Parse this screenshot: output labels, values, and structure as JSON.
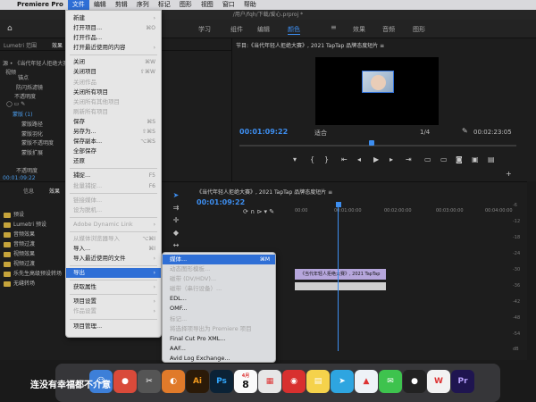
{
  "menubar": {
    "app_name": "Premiere Pro",
    "items": [
      "文件",
      "编辑",
      "剪辑",
      "序列",
      "标记",
      "图形",
      "视图",
      "窗口",
      "帮助"
    ]
  },
  "app_header": {
    "path": "/用户/fqh/下载/爱心.prproj *"
  },
  "workspaces": {
    "items": [
      "学习",
      "组件",
      "编辑",
      "颜色",
      "效果",
      "音频",
      "图形"
    ],
    "active": "颜色"
  },
  "left_top": {
    "tabs": [
      "Lumetri 范围",
      "效果"
    ],
    "rows": [
      "源 • 《当代年轻人拒绝大赛》",
      "视频",
      "锚点",
      "防闪烁滤镜",
      "不透明度",
      "蒙版 (1)",
      "蒙版路径",
      "蒙版羽化",
      "蒙版不透明度",
      "蒙版扩展",
      "不透明度"
    ],
    "timecode": "00:01:09:22"
  },
  "left_bottom": {
    "tabs": [
      "信息",
      "效果"
    ],
    "folders": [
      "预设",
      "Lumetri 预设",
      "音频效果",
      "音频过渡",
      "视频效果",
      "视频过渡",
      "乐先生高级预设转场",
      "无缝转场"
    ]
  },
  "program": {
    "title": "节目:《当代年轻人拒绝大赛》, 2021 TapTap 品牌态度短片 ≡",
    "timecode": "00:01:09:22",
    "fit": "适合",
    "quality": "1/4",
    "duration": "00:02:23:05"
  },
  "timeline": {
    "title": "《当代年轻人拒绝大赛》, 2021 TapTap 品牌态度短片 ≡",
    "timecode": "00:01:09:22",
    "ruler": [
      "00:00",
      "00:01:00:00",
      "00:02:00:00",
      "00:03:00:00",
      "00:04:00:00"
    ],
    "clip_video": "《当代年轻人拒绝大赛》, 2021 TapTap",
    "meter_labels": [
      "-6",
      "-12",
      "-18",
      "-24",
      "-30",
      "-36",
      "-42",
      "-48",
      "-54",
      "dB"
    ]
  },
  "file_menu": [
    {
      "label": "新建",
      "sc": "›",
      "dis": false
    },
    {
      "label": "打开项目...",
      "sc": "⌘O",
      "dis": false
    },
    {
      "label": "打开作品...",
      "sc": "",
      "dis": false
    },
    {
      "label": "打开最近使用的内容",
      "sc": "›",
      "dis": false
    },
    {
      "sep": true
    },
    {
      "label": "关闭",
      "sc": "⌘W",
      "dis": false
    },
    {
      "label": "关闭项目",
      "sc": "⇧⌘W",
      "dis": false
    },
    {
      "label": "关闭作品",
      "sc": "",
      "dis": true
    },
    {
      "label": "关闭所有项目",
      "sc": "",
      "dis": false
    },
    {
      "label": "关闭所有其他项目",
      "sc": "",
      "dis": true
    },
    {
      "label": "刷新所有项目",
      "sc": "",
      "dis": true
    },
    {
      "label": "保存",
      "sc": "⌘S",
      "dis": false
    },
    {
      "label": "另存为...",
      "sc": "⇧⌘S",
      "dis": false
    },
    {
      "label": "保存副本...",
      "sc": "⌥⌘S",
      "dis": false
    },
    {
      "label": "全部保存",
      "sc": "",
      "dis": false
    },
    {
      "label": "还原",
      "sc": "",
      "dis": false
    },
    {
      "sep": true
    },
    {
      "label": "捕捉...",
      "sc": "F5",
      "dis": false
    },
    {
      "label": "批量捕捉...",
      "sc": "F6",
      "dis": true
    },
    {
      "sep": true
    },
    {
      "label": "链接媒体...",
      "sc": "",
      "dis": true
    },
    {
      "label": "设为脱机...",
      "sc": "",
      "dis": true
    },
    {
      "sep": true
    },
    {
      "label": "Adobe Dynamic Link",
      "sc": "›",
      "dis": true
    },
    {
      "sep": true
    },
    {
      "label": "从媒体浏览器导入",
      "sc": "⌥⌘I",
      "dis": true
    },
    {
      "label": "导入...",
      "sc": "⌘I",
      "dis": false
    },
    {
      "label": "导入最近使用的文件",
      "sc": "›",
      "dis": false
    },
    {
      "sep": true
    },
    {
      "label": "导出",
      "sc": "›",
      "dis": false,
      "hl": true
    },
    {
      "sep": true
    },
    {
      "label": "获取属性",
      "sc": "›",
      "dis": false
    },
    {
      "sep": true
    },
    {
      "label": "项目设置",
      "sc": "›",
      "dis": false
    },
    {
      "label": "作品设置",
      "sc": "›",
      "dis": true
    },
    {
      "sep": true
    },
    {
      "label": "项目管理...",
      "sc": "",
      "dis": false
    }
  ],
  "export_menu": [
    {
      "label": "媒体...",
      "sc": "⌘M",
      "dis": false,
      "hl": true
    },
    {
      "label": "动态图形模板...",
      "sc": "",
      "dis": true
    },
    {
      "label": "磁带 (DV/HDV)...",
      "sc": "",
      "dis": true
    },
    {
      "label": "磁带（串行设备）...",
      "sc": "",
      "dis": true
    },
    {
      "label": "EDL...",
      "sc": "",
      "dis": false
    },
    {
      "label": "OMF...",
      "sc": "",
      "dis": false
    },
    {
      "label": "标记...",
      "sc": "",
      "dis": true
    },
    {
      "label": "将选择项导出为 Premiere 项目",
      "sc": "",
      "dis": true
    },
    {
      "label": "Final Cut Pro XML...",
      "sc": "",
      "dis": false
    },
    {
      "label": "AAF...",
      "sc": "",
      "dis": false
    },
    {
      "label": "Avid Log Exchange...",
      "sc": "",
      "dis": false
    }
  ],
  "dock": {
    "caption": "连没有幸福都不介意",
    "calendar_day": "8",
    "calendar_month": "4月",
    "icons": [
      {
        "name": "finder-icon",
        "glyph": "☺",
        "bg": "#3d7fd8"
      },
      {
        "name": "chrome-icon",
        "glyph": "●",
        "bg": "#d94a3a"
      },
      {
        "name": "screenshot-icon",
        "glyph": "✂",
        "bg": "#555"
      },
      {
        "name": "color-picker-icon",
        "glyph": "◐",
        "bg": "#e07a2a"
      },
      {
        "name": "illustrator-icon",
        "glyph": "Ai",
        "bg": "#2b1a08"
      },
      {
        "name": "photoshop-icon",
        "glyph": "Ps",
        "bg": "#0b2236"
      },
      {
        "name": "calendar-icon",
        "glyph": "",
        "bg": "#fafafa"
      },
      {
        "name": "launchpad-icon",
        "glyph": "▦",
        "bg": "#e6e6e6"
      },
      {
        "name": "netease-music-icon",
        "glyph": "◉",
        "bg": "#d8302f"
      },
      {
        "name": "notes-icon",
        "glyph": "▤",
        "bg": "#f5d24b"
      },
      {
        "name": "telegram-icon",
        "glyph": "➤",
        "bg": "#2ea5e0"
      },
      {
        "name": "vpn-icon",
        "glyph": "▲",
        "bg": "#eef2f7"
      },
      {
        "name": "wechat-icon",
        "glyph": "✉",
        "bg": "#3ec34e"
      },
      {
        "name": "qq-icon",
        "glyph": "●",
        "bg": "#222"
      },
      {
        "name": "wps-icon",
        "glyph": "W",
        "bg": "#f2f2f2"
      },
      {
        "name": "premiere-icon",
        "glyph": "Pr",
        "bg": "#1f1550"
      }
    ]
  }
}
